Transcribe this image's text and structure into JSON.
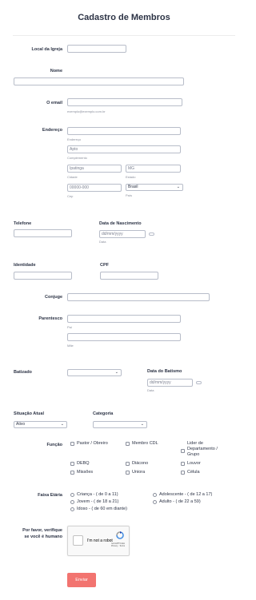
{
  "form": {
    "title": "Cadastro de Membros",
    "local_igreja": {
      "label": "Local da Igreja",
      "value": ""
    },
    "nome": {
      "label": "Nome",
      "value": ""
    },
    "email": {
      "label": "O email",
      "value": "",
      "hint": "exemplo@exemplo.com.br"
    },
    "endereco": {
      "label": "Endereço",
      "street": {
        "value": "",
        "sub": "Endereço"
      },
      "complemento": {
        "value": "Apto",
        "sub": "Complemento"
      },
      "cidade": {
        "value": "Ipatinga",
        "sub": "Cidade"
      },
      "estado": {
        "value": "MG",
        "sub": "Estado"
      },
      "cep": {
        "placeholder": "00000-000",
        "sub": "Cep"
      },
      "pais": {
        "value": "Brasil",
        "sub": "País"
      }
    },
    "telefone": {
      "label": "Telefone",
      "value": ""
    },
    "nascimento": {
      "label": "Data de Nascimento",
      "placeholder": "dd/mm/yyyy",
      "sub": "Data"
    },
    "identidade": {
      "label": "Identidade",
      "value": ""
    },
    "cpf": {
      "label": "CPF",
      "value": ""
    },
    "conjuge": {
      "label": "Conjuge",
      "value": ""
    },
    "parentesco": {
      "label": "Parentesco",
      "pai_sub": "Pai",
      "mae_sub": "Mãe"
    },
    "batizado": {
      "label": "Batizado",
      "value": ""
    },
    "data_batismo": {
      "label": "Data do Batismo",
      "placeholder": "dd/mm/yyyy",
      "sub": "Data"
    },
    "situacao": {
      "label": "Situação Atual",
      "value": "Ativo"
    },
    "categoria": {
      "label": "Categoria",
      "value": ""
    },
    "funcao": {
      "label": "Função",
      "options": [
        "Pastor / Obreiro",
        "Membro CDL",
        "Lider de Departamento / Grupo",
        "DEBQ",
        "Diácono",
        "Louvor",
        "Missões",
        "Uniora",
        "Célula"
      ]
    },
    "faixa": {
      "label": "Faixa Etária",
      "options": [
        "Criança - ( de 0 a 11)",
        "Adolescente - ( de 12 a 17)",
        "Jovem - ( de 18 a 21)",
        "Adulto - ( de 22 a 59)",
        "Idoso - ( de 60 em diante)"
      ]
    },
    "captcha": {
      "label_line1": "Por favor, verifique",
      "label_line2": "se você é humano",
      "text": "I'm not a robot",
      "brand": "reCAPTCHA",
      "links": "Privacy - Terms"
    },
    "submit": "Enviar"
  },
  "colors": {
    "accent": "#f27470",
    "text": "#2c3345",
    "border": "#b8bdc9"
  }
}
